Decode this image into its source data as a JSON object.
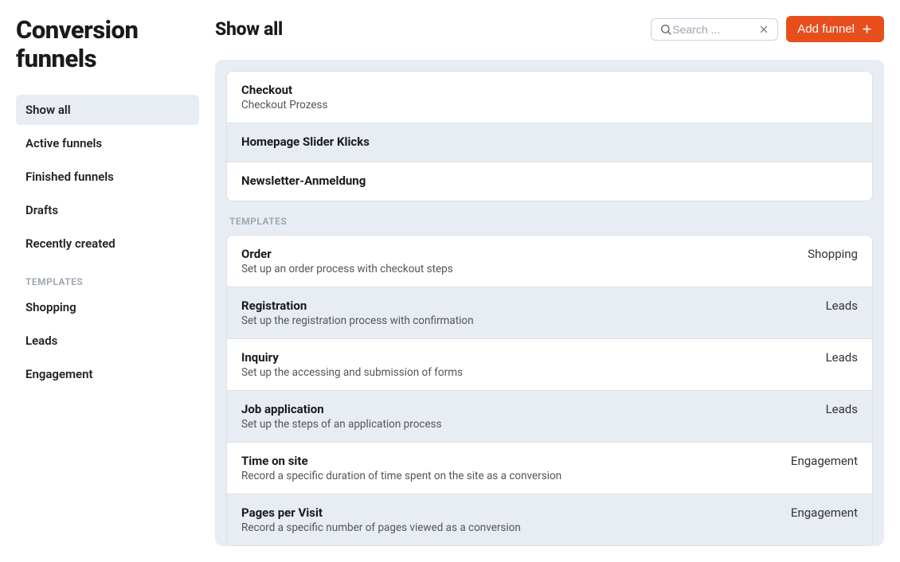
{
  "page_title": "Conversion funnels",
  "sidebar": {
    "items": [
      {
        "label": "Show all",
        "active": true
      },
      {
        "label": "Active funnels",
        "active": false
      },
      {
        "label": "Finished funnels",
        "active": false
      },
      {
        "label": "Drafts",
        "active": false
      },
      {
        "label": "Recently created",
        "active": false
      }
    ],
    "section_label": "TEMPLATES",
    "template_items": [
      {
        "label": "Shopping"
      },
      {
        "label": "Leads"
      },
      {
        "label": "Engagement"
      }
    ]
  },
  "header": {
    "title": "Show all",
    "search_placeholder": "Search ...",
    "add_button_label": "Add funnel"
  },
  "funnels": [
    {
      "title": "Checkout",
      "subtitle": "Checkout Prozess"
    },
    {
      "title": "Homepage Slider Klicks",
      "subtitle": ""
    },
    {
      "title": "Newsletter-Anmeldung",
      "subtitle": ""
    }
  ],
  "templates_section_label": "TEMPLATES",
  "templates": [
    {
      "title": "Order",
      "subtitle": "Set up an order process with checkout steps",
      "category": "Shopping"
    },
    {
      "title": "Registration",
      "subtitle": "Set up the registration process with confirmation",
      "category": "Leads"
    },
    {
      "title": "Inquiry",
      "subtitle": "Set up the accessing and submission of forms",
      "category": "Leads"
    },
    {
      "title": "Job application",
      "subtitle": "Set up the steps of an application process",
      "category": "Leads"
    },
    {
      "title": "Time on site",
      "subtitle": "Record a specific duration of time spent on the site as a conversion",
      "category": "Engagement"
    },
    {
      "title": "Pages per Visit",
      "subtitle": "Record a specific number of pages viewed as a conversion",
      "category": "Engagement"
    }
  ]
}
